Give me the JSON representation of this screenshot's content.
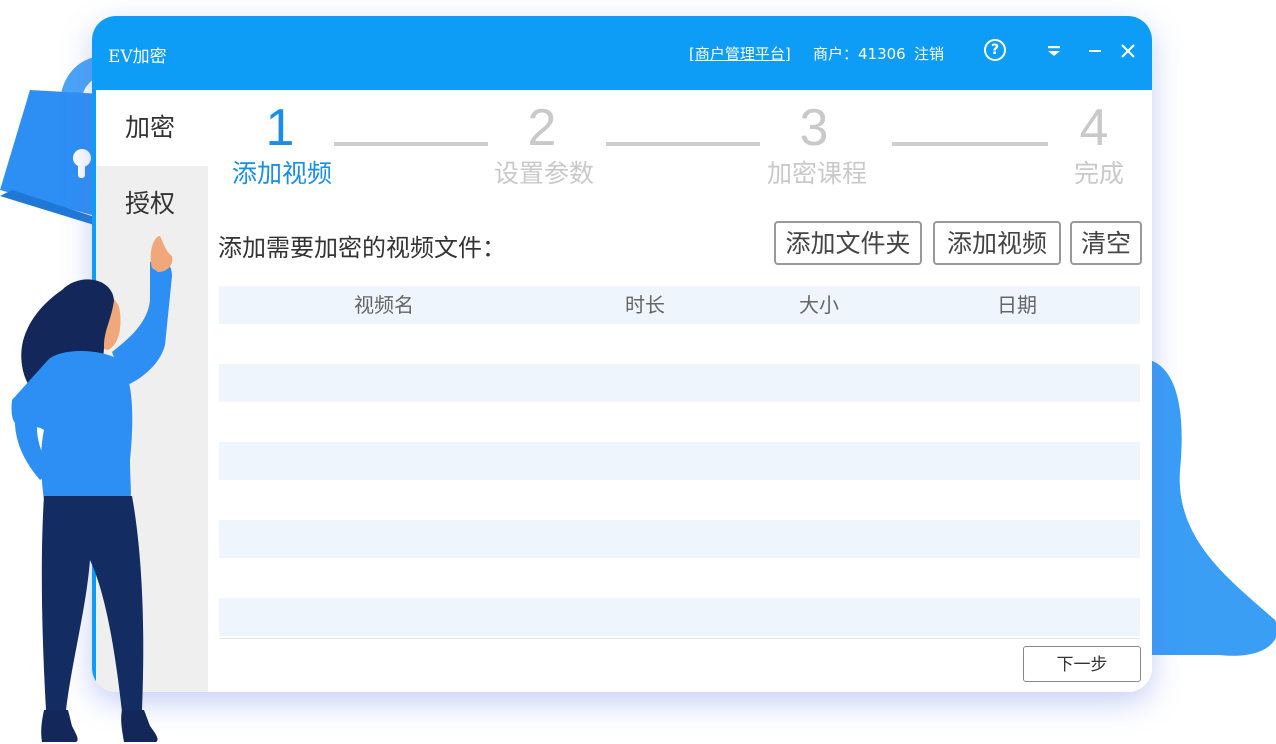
{
  "window": {
    "app_title": "EV加密",
    "merchant_platform_link": "[商户管理平台]",
    "merchant_info": "商户：41306",
    "logout": "注销",
    "help_glyph": "?"
  },
  "sidebar": {
    "items": [
      {
        "label": "加密",
        "active": true
      },
      {
        "label": "授权",
        "active": false
      }
    ]
  },
  "stepper": {
    "steps": [
      {
        "number": "1",
        "label": "添加视频",
        "active": true
      },
      {
        "number": "2",
        "label": "设置参数",
        "active": false
      },
      {
        "number": "3",
        "label": "加密课程",
        "active": false
      },
      {
        "number": "4",
        "label": "完成",
        "active": false
      }
    ]
  },
  "main": {
    "instruction": "添加需要加密的视频文件：",
    "buttons": {
      "add_folder": "添加文件夹",
      "add_video": "添加视频",
      "clear": "清空"
    },
    "table": {
      "columns": [
        "视频名",
        "时长",
        "大小",
        "日期"
      ],
      "rows": []
    },
    "next_button": "下一步"
  },
  "colors": {
    "titlebar": "#0d9cf6",
    "accent": "#1a8de6",
    "inactive_step": "#c9c9c9",
    "table_stripe": "#eef5fd",
    "illustration_blue": "#2d8ff4",
    "illustration_navy": "#132c61"
  },
  "icons": {
    "help": "help-circle-icon",
    "menu": "dropdown-menu-icon",
    "minimize": "minimize-icon",
    "close": "close-icon"
  }
}
